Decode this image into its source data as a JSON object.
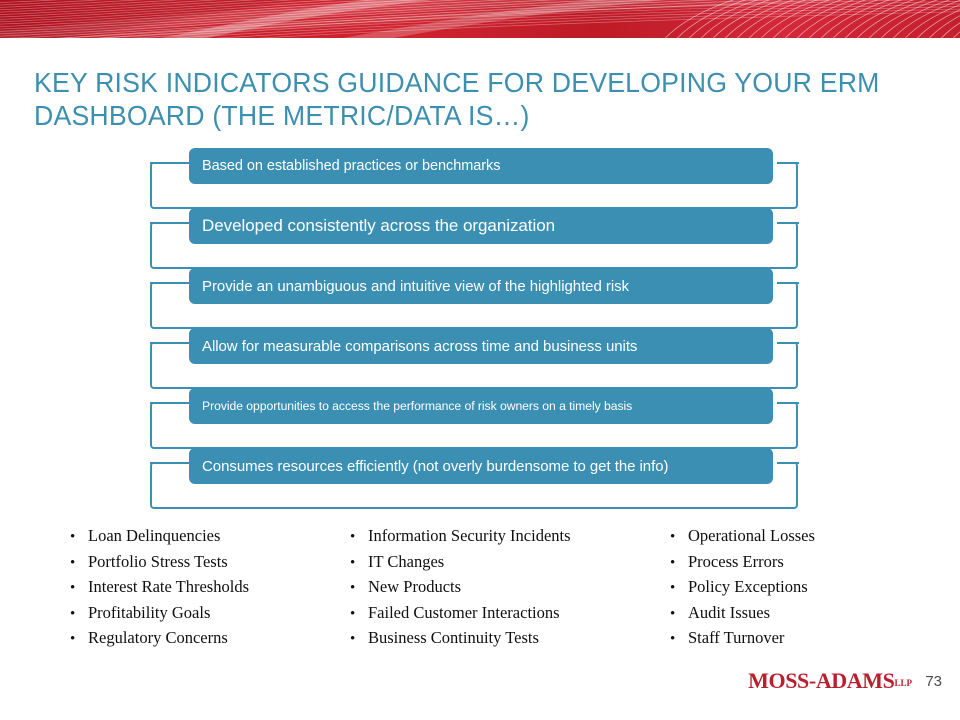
{
  "slide": {
    "title": "KEY RISK INDICATORS GUIDANCE FOR DEVELOPING YOUR ERM DASHBOARD  (THE METRIC/DATA IS…)",
    "accent_teal": "#3a8fb3",
    "accent_red": "#b9202f",
    "title_color": "#3d8fb0"
  },
  "process": {
    "items": [
      {
        "label": "Based on established practices or benchmarks"
      },
      {
        "label": "Developed consistently across the organization"
      },
      {
        "label": "Provide an unambiguous and intuitive view of the highlighted risk"
      },
      {
        "label": "Allow for measurable comparisons across time and business units"
      },
      {
        "label": "Provide opportunities to access the performance of risk owners on a timely basis"
      },
      {
        "label": "Consumes resources efficiently (not overly burdensome to get the info)"
      }
    ]
  },
  "examples": {
    "column1": [
      "Loan Delinquencies",
      "Portfolio Stress Tests",
      "Interest Rate Thresholds",
      "Profitability Goals",
      "Regulatory Concerns"
    ],
    "column2": [
      "Information Security Incidents",
      "IT Changes",
      "New Products",
      "Failed Customer Interactions",
      "Business Continuity Tests"
    ],
    "column3": [
      "Operational Losses",
      "Process Errors",
      "Policy Exceptions",
      "Audit Issues",
      "Staff Turnover"
    ],
    "bullet_glyph": "•"
  },
  "footer": {
    "logo_text": "MOSS-ADAMS",
    "logo_suffix": "LLP",
    "page_number": "73"
  }
}
